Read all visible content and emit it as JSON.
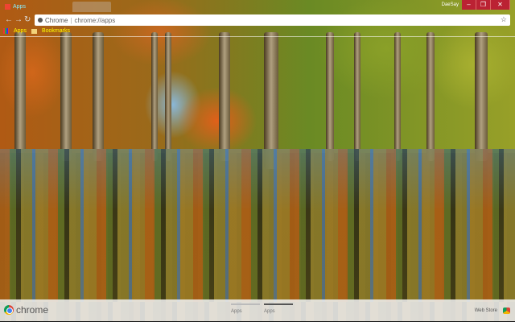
{
  "tabs": [
    {
      "label": "Apps"
    },
    {
      "label": ""
    }
  ],
  "window": {
    "user": "DaeSay",
    "minimize": "–",
    "restore": "❐",
    "close": "✕"
  },
  "nav": {
    "back": "←",
    "forward": "→",
    "reload": "↻"
  },
  "omnibox": {
    "site": "Chrome",
    "separator": "|",
    "url": "chrome://apps",
    "star": "☆"
  },
  "bookmarks": [
    {
      "label": "Apps"
    },
    {
      "label": "Bookmarks"
    }
  ],
  "footer": {
    "brand": "chrome",
    "pages": [
      {
        "label": "Apps",
        "active": false
      },
      {
        "label": "Apps",
        "active": true
      }
    ],
    "web_store": "Web Store"
  }
}
